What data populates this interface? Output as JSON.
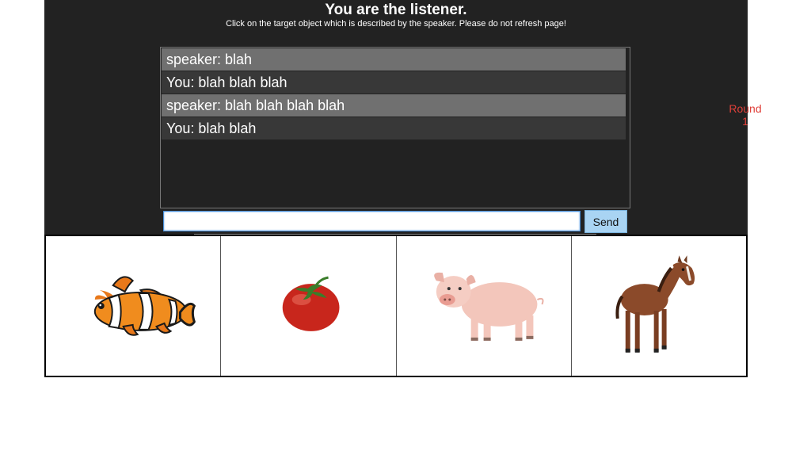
{
  "header": {
    "title": "You are the listener.",
    "instructions": "Click on the target object which is described by the speaker. Please do not refresh page!"
  },
  "chat": {
    "messages": [
      {
        "role": "speaker",
        "text": "speaker: blah"
      },
      {
        "role": "you",
        "text": "You: blah blah blah"
      },
      {
        "role": "speaker",
        "text": "speaker: blah blah blah blah"
      },
      {
        "role": "you",
        "text": "You: blah blah"
      }
    ],
    "input_value": "",
    "send_label": "Send"
  },
  "round": {
    "label": "Round",
    "number": "1"
  },
  "objects": [
    {
      "name": "clownfish",
      "icon": "clownfish-image"
    },
    {
      "name": "tomato",
      "icon": "tomato-image"
    },
    {
      "name": "pig",
      "icon": "pig-image"
    },
    {
      "name": "horse",
      "icon": "horse-image"
    }
  ],
  "colors": {
    "panel_bg": "#222222",
    "speaker_row": "#707070",
    "you_row": "#383838",
    "send_button": "#a9d4f3",
    "round_text": "#e0403a"
  }
}
